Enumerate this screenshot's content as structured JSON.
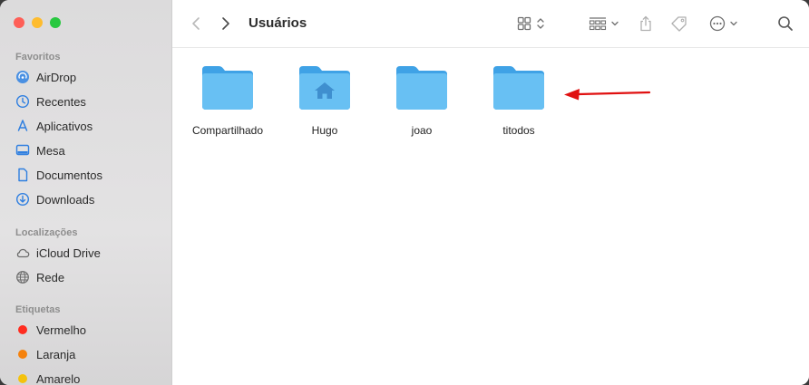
{
  "window": {
    "title": "Usuários"
  },
  "sidebar": {
    "favorites_title": "Favoritos",
    "favorites": [
      {
        "label": "AirDrop",
        "icon": "airdrop-icon"
      },
      {
        "label": "Recentes",
        "icon": "clock-icon"
      },
      {
        "label": "Aplicativos",
        "icon": "applications-icon"
      },
      {
        "label": "Mesa",
        "icon": "desktop-icon"
      },
      {
        "label": "Documentos",
        "icon": "document-icon"
      },
      {
        "label": "Downloads",
        "icon": "download-icon"
      }
    ],
    "locations_title": "Localizações",
    "locations": [
      {
        "label": "iCloud Drive",
        "icon": "cloud-icon"
      },
      {
        "label": "Rede",
        "icon": "network-icon"
      }
    ],
    "tags_title": "Etiquetas",
    "tags": [
      {
        "label": "Vermelho",
        "color": "#ff2d20"
      },
      {
        "label": "Laranja",
        "color": "#f5820d"
      },
      {
        "label": "Amarelo",
        "color": "#f4c20d"
      }
    ]
  },
  "folders": [
    {
      "label": "Compartilhado",
      "home": false
    },
    {
      "label": "Hugo",
      "home": true
    },
    {
      "label": "joao",
      "home": false
    },
    {
      "label": "titodos",
      "home": false
    }
  ],
  "colors": {
    "accent": "#1e88f5",
    "folder": "#5ab8f0",
    "arrow": "#e01010"
  }
}
